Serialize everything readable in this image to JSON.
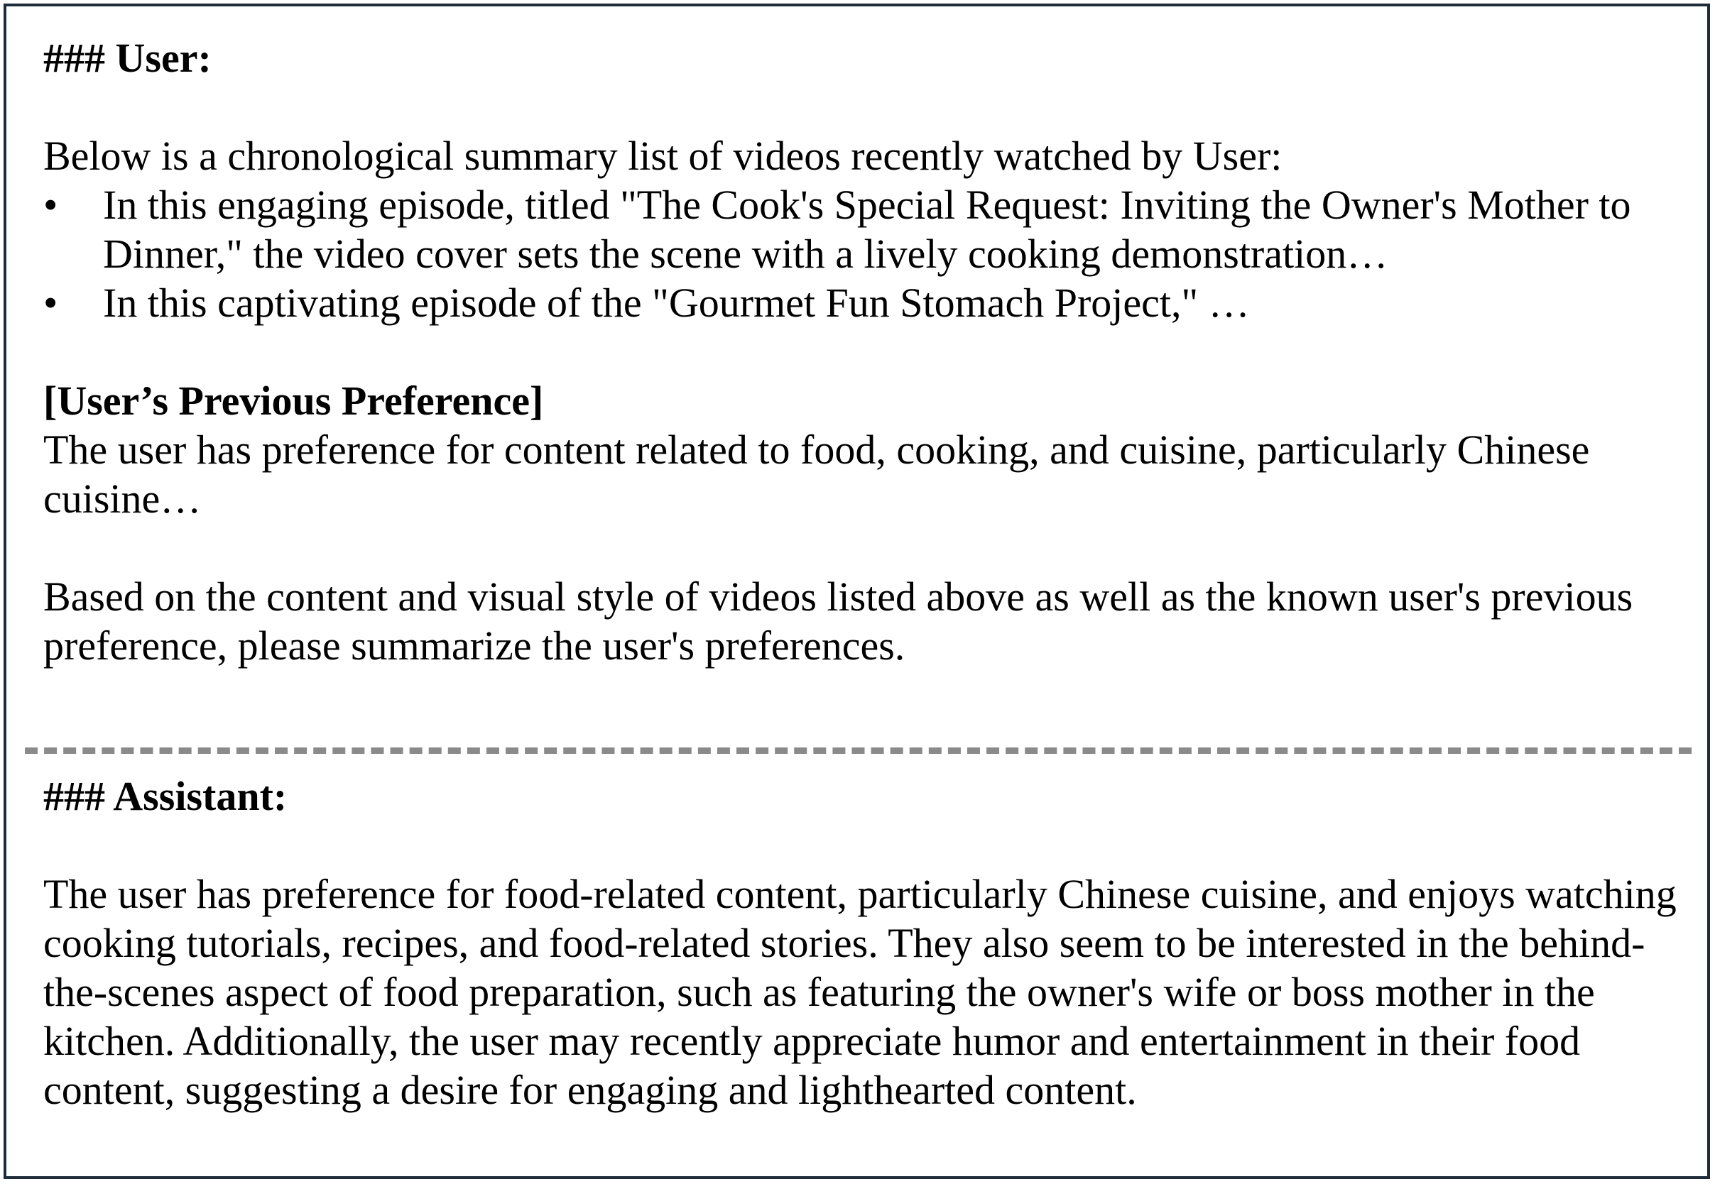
{
  "user": {
    "heading": "### User:",
    "intro": "Below is a chronological summary list of videos recently watched by User:",
    "videos": [
      "In this engaging episode, titled \"The Cook's Special Request: Inviting the Owner's Mother to Dinner,\" the video cover sets the scene with a lively cooking demonstration…",
      "In this captivating episode of the \"Gourmet Fun Stomach Project,\" …"
    ],
    "bullet_glyph": "•",
    "previous_preference_heading": "[User’s Previous Preference]",
    "previous_preference_text": "The user has preference for content related to food, cooking, and cuisine, particularly Chinese cuisine…",
    "instruction": "Based on the content and visual style of videos listed above as well as the known user's previous preference, please summarize the user's preferences."
  },
  "assistant": {
    "heading": "### Assistant:",
    "response": "The user has preference for food-related content, particularly Chinese cuisine, and enjoys watching cooking tutorials, recipes, and food-related stories. They also seem to be interested in the behind-the-scenes aspect of food preparation, such as featuring the owner's wife or boss mother in the kitchen. Additionally, the user may recently appreciate humor and entertainment in their food content, suggesting a desire for engaging and lighthearted content."
  },
  "colors": {
    "border": "#1d2b3a",
    "divider": "#8a8a8a",
    "text": "#000000"
  }
}
